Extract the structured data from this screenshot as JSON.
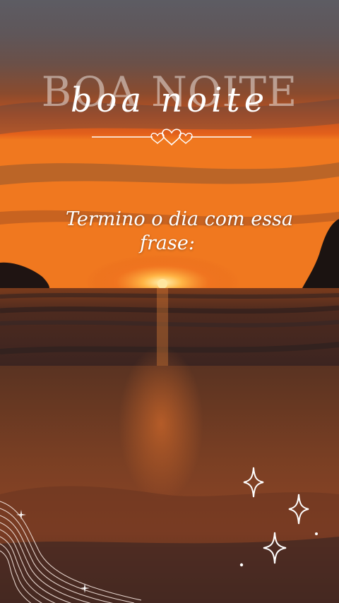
{
  "title": {
    "serif_text": "BOA NOITE",
    "script_text": "boa noite"
  },
  "quote": {
    "line1": "Termino o dia com essa",
    "line2": "frase:"
  },
  "decor": {
    "divider_icon": "hearts-divider-icon",
    "sparkle_icon": "sparkle-star-icon",
    "waves_icon": "wave-lines-icon"
  },
  "colors": {
    "sun": "#ffcf6a",
    "sky_top": "#5b5a61",
    "horizon": "#e2571c",
    "text": "#ffffff"
  }
}
